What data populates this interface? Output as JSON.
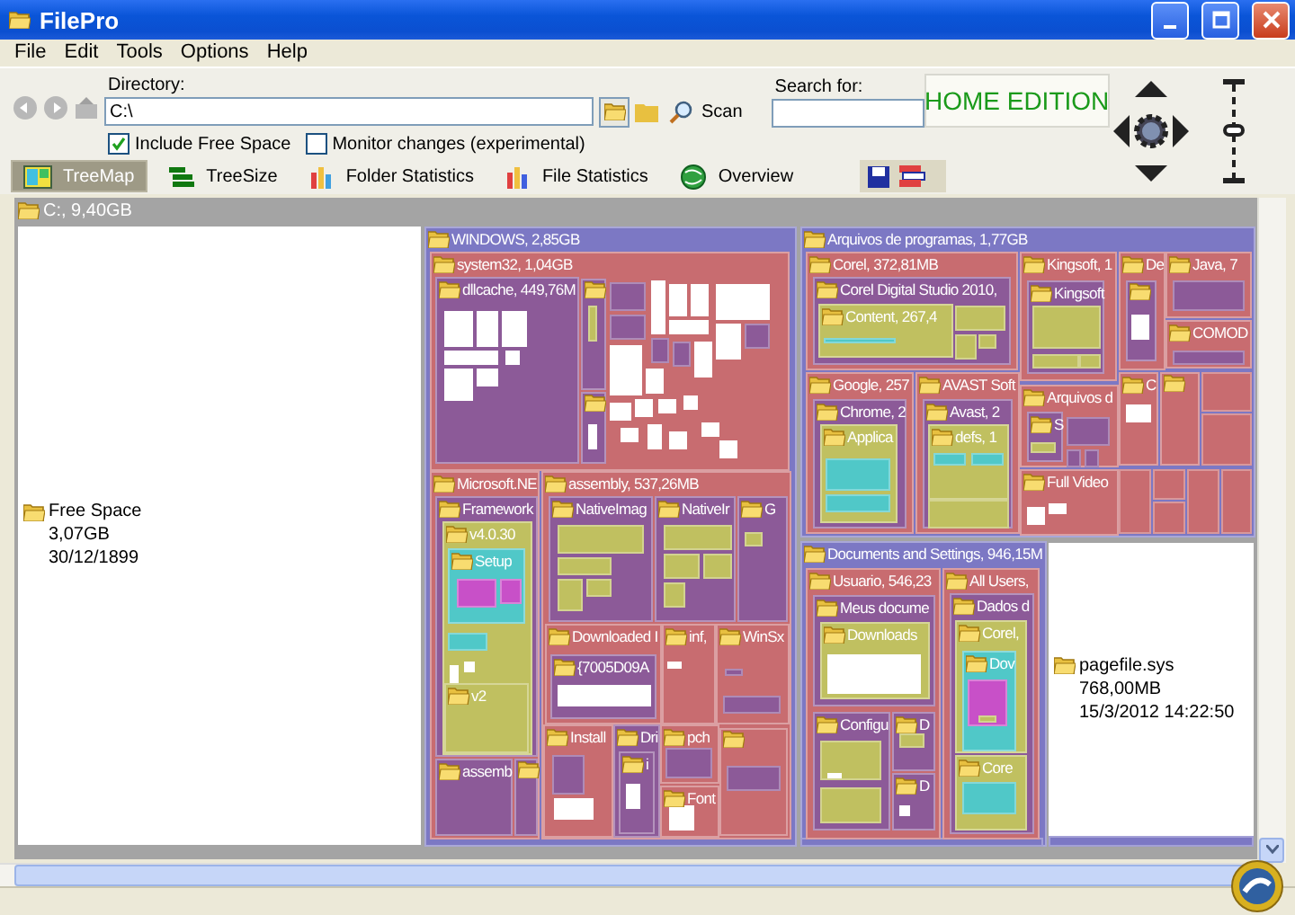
{
  "window": {
    "title": "FilePro"
  },
  "menu": [
    "File",
    "Edit",
    "Tools",
    "Options",
    "Help"
  ],
  "directory": {
    "label": "Directory:",
    "value": "C:\\"
  },
  "scan": "Scan",
  "search": {
    "label": "Search for:"
  },
  "edition": "HOME EDITION",
  "zoom": {
    "level": 0.5
  },
  "options": [
    {
      "label": "Include Free Space",
      "checked": true
    },
    {
      "label": "Monitor changes (experimental)",
      "checked": false
    }
  ],
  "views": [
    {
      "label": "TreeMap",
      "kind": "treemap",
      "selected": true
    },
    {
      "label": "TreeSize",
      "kind": "treesize",
      "selected": false
    },
    {
      "label": "Folder Statistics",
      "kind": "folder-stats",
      "selected": false
    },
    {
      "label": "File Statistics",
      "kind": "file-stats",
      "selected": false
    },
    {
      "label": "Overview",
      "kind": "overview",
      "selected": false
    }
  ],
  "treemap": {
    "root": "C:, 9,40GB",
    "nodes": [
      {
        "kind": "file",
        "lines": [
          "Free Space",
          "3,07GB",
          "30/12/1899"
        ]
      },
      {
        "kind": "folder",
        "label": "WINDOWS, 2,85GB",
        "color": "#7c78c4",
        "children": [
          {
            "kind": "folder",
            "label": "system32, 1,04GB",
            "color": "#c86c70",
            "children": [
              {
                "kind": "folder",
                "label": "dllcache, 449,76M",
                "color": "#8c5a98"
              },
              {
                "kind": "folder",
                "color": "#8c5a98"
              },
              {
                "kind": "folder",
                "color": "#8c5a98"
              }
            ]
          },
          {
            "kind": "folder",
            "label": "Microsoft.NE",
            "color": "#c86c70",
            "children": [
              {
                "kind": "folder",
                "label": "Framework",
                "color": "#8c5a98",
                "children": [
                  {
                    "kind": "folder",
                    "label": "v4.0.30",
                    "color": "#c0c060",
                    "children": [
                      {
                        "kind": "folder",
                        "label": "Setup",
                        "color": "#50c8c8"
                      },
                      {
                        "kind": "folder",
                        "label": "v2",
                        "color": "#c0c060"
                      }
                    ]
                  }
                ]
              },
              {
                "kind": "folder",
                "label": "assemb",
                "color": "#8c5a98"
              },
              {
                "kind": "folder",
                "color": "#8c5a98"
              }
            ]
          },
          {
            "kind": "folder",
            "label": "assembly, 537,26MB",
            "color": "#c86c70",
            "children": [
              {
                "kind": "folder",
                "label": "NativeImag",
                "color": "#8c5a98"
              },
              {
                "kind": "folder",
                "label": "NativeIr",
                "color": "#8c5a98"
              },
              {
                "kind": "folder",
                "label": "G",
                "color": "#8c5a98"
              },
              {
                "kind": "folder",
                "label": "Downloaded I",
                "color": "#c86c70",
                "children": [
                  {
                    "kind": "folder",
                    "label": "{7005D09A",
                    "color": "#8c5a98"
                  }
                ]
              },
              {
                "kind": "folder",
                "label": "inf,",
                "color": "#c86c70"
              },
              {
                "kind": "folder",
                "label": "WinSx",
                "color": "#c86c70"
              },
              {
                "kind": "folder",
                "label": "Install",
                "color": "#c86c70"
              },
              {
                "kind": "folder",
                "label": "Dri",
                "color": "#8c5a98",
                "children": [
                  {
                    "kind": "folder",
                    "label": "i",
                    "color": "#8c5a98"
                  }
                ]
              },
              {
                "kind": "folder",
                "label": "pch",
                "color": "#c86c70"
              },
              {
                "kind": "folder",
                "label": "Font",
                "color": "#c86c70"
              },
              {
                "kind": "folder",
                "color": "#c86c70"
              }
            ]
          }
        ]
      },
      {
        "kind": "folder",
        "label": "Arquivos de programas, 1,77GB",
        "color": "#7c78c4",
        "children": [
          {
            "kind": "folder",
            "label": "Corel, 372,81MB",
            "color": "#c86c70",
            "children": [
              {
                "kind": "folder",
                "label": "Corel Digital Studio 2010,",
                "color": "#8c5a98",
                "children": [
                  {
                    "kind": "folder",
                    "label": "Content, 267,4",
                    "color": "#c0c060"
                  }
                ]
              }
            ]
          },
          {
            "kind": "folder",
            "label": "Kingsoft, 1",
            "color": "#c86c70",
            "children": [
              {
                "kind": "folder",
                "label": "Kingsoft",
                "color": "#8c5a98"
              }
            ]
          },
          {
            "kind": "folder",
            "label": "De",
            "color": "#c86c70",
            "children": [
              {
                "kind": "folder",
                "color": "#8c5a98"
              }
            ]
          },
          {
            "kind": "folder",
            "label": "Java, 7",
            "color": "#c86c70"
          },
          {
            "kind": "folder",
            "label": "COMOD",
            "color": "#c86c70"
          },
          {
            "kind": "folder",
            "label": "Google, 257",
            "color": "#c86c70",
            "children": [
              {
                "kind": "folder",
                "label": "Chrome, 2",
                "color": "#8c5a98",
                "children": [
                  {
                    "kind": "folder",
                    "label": "Applica",
                    "color": "#c0c060"
                  }
                ]
              }
            ]
          },
          {
            "kind": "folder",
            "label": "AVAST Soft",
            "color": "#c86c70",
            "children": [
              {
                "kind": "folder",
                "label": "Avast, 2",
                "color": "#8c5a98",
                "children": [
                  {
                    "kind": "folder",
                    "label": "defs, 1",
                    "color": "#c0c060"
                  }
                ]
              }
            ]
          },
          {
            "kind": "folder",
            "label": "Arquivos d",
            "color": "#c86c70",
            "children": [
              {
                "kind": "folder",
                "label": "S",
                "color": "#8c5a98"
              }
            ]
          },
          {
            "kind": "folder",
            "label": "Full Video",
            "color": "#c86c70"
          },
          {
            "kind": "folder",
            "label": "C",
            "color": "#c86c70"
          },
          {
            "kind": "folder",
            "color": "#c86c70"
          }
        ]
      },
      {
        "kind": "folder",
        "label": "Documents and Settings, 946,15M",
        "color": "#7c78c4",
        "children": [
          {
            "kind": "folder",
            "label": "Usuario, 546,23",
            "color": "#c86c70",
            "children": [
              {
                "kind": "folder",
                "label": "Meus docume",
                "color": "#8c5a98",
                "children": [
                  {
                    "kind": "folder",
                    "label": "Downloads",
                    "color": "#c0c060"
                  }
                ]
              },
              {
                "kind": "folder",
                "label": "Configu",
                "color": "#8c5a98"
              },
              {
                "kind": "folder",
                "label": "D",
                "color": "#8c5a98"
              },
              {
                "kind": "folder",
                "label": "D",
                "color": "#8c5a98"
              }
            ]
          },
          {
            "kind": "folder",
            "label": "All Users,",
            "color": "#c86c70",
            "children": [
              {
                "kind": "folder",
                "label": "Dados d",
                "color": "#8c5a98",
                "children": [
                  {
                    "kind": "folder",
                    "label": "Corel,",
                    "color": "#c0c060",
                    "children": [
                      {
                        "kind": "folder",
                        "label": "Dov",
                        "color": "#50c8c8"
                      }
                    ]
                  },
                  {
                    "kind": "folder",
                    "label": "Core",
                    "color": "#c0c060"
                  }
                ]
              }
            ]
          }
        ]
      },
      {
        "kind": "file",
        "lines": [
          "pagefile.sys",
          "768,00MB",
          "15/3/2012 14:22:50"
        ]
      }
    ]
  }
}
